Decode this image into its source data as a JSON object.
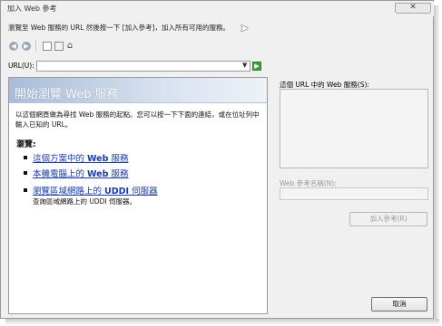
{
  "window": {
    "title": "加入 Web 參考",
    "close_glyph": "✕"
  },
  "instruction": "瀏覽至 Web 服務的 URL 然後按一下 [加入參考]，加入所有可用的服務。",
  "toolbar": {
    "back_glyph": "◀",
    "forward_glyph": "▶",
    "home_glyph": "⌂"
  },
  "url": {
    "label": "URL(U):",
    "value": "",
    "dropdown_glyph": "▼",
    "go_glyph": "▶"
  },
  "browser": {
    "title": "開始瀏覽 Web 服務",
    "intro": "以這個網頁做為尋找 Web 服務的起點。您可以按一下下面的連結，或在位址列中輸入已知的 URL。",
    "browse_heading": "瀏覽:",
    "links": [
      {
        "text_a": "這個方案中的 ",
        "bold": "Web",
        "text_b": " 服務"
      },
      {
        "text_a": "本機電腦上的 ",
        "bold": "Web",
        "text_b": " 服務"
      },
      {
        "text_a": "瀏覽區域網路上的 ",
        "bold": "UDDI",
        "text_b": " 伺服器"
      }
    ],
    "link3_description": "查詢區域網路上的 UDDI 伺服器。"
  },
  "right_pane": {
    "services_label": "這個 URL 中的 Web 服務(S):",
    "refname_label": "Web 參考名稱(N):",
    "refname_value": "",
    "add_reference_label": "加入參考(R)"
  },
  "footer": {
    "cancel_label": "取消"
  },
  "colors": {
    "link": "#1a3aa8",
    "header_gradient_start": "#a9bcd8",
    "go_green": "#3aa43a"
  }
}
